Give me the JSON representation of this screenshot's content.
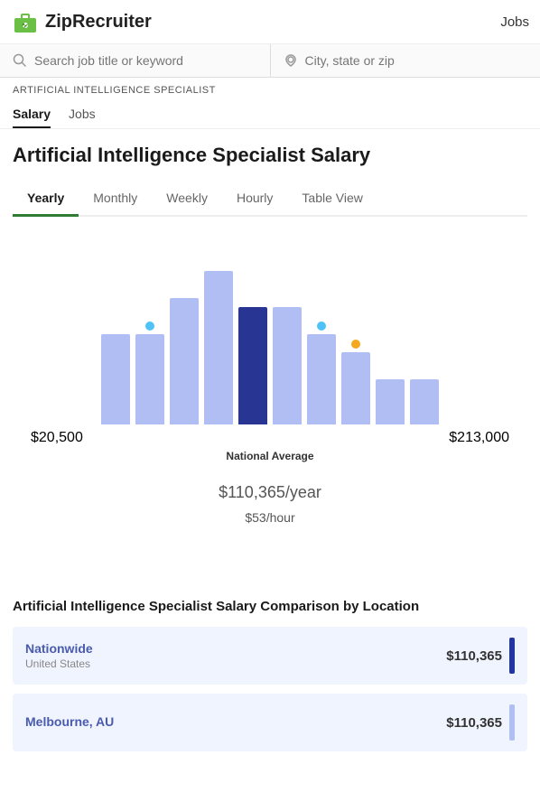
{
  "header": {
    "logo_text": "ZipRecruiter",
    "jobs_link": "Jobs"
  },
  "search": {
    "job_placeholder": "Search job title or keyword",
    "location_placeholder": "City, state or zip"
  },
  "breadcrumb": "ARTIFICIAL INTELLIGENCE SPECIALIST",
  "section_tabs": [
    {
      "label": "Salary",
      "active": true
    },
    {
      "label": "Jobs",
      "active": false
    }
  ],
  "page_title": "Artificial Intelligence Specialist Salary",
  "period_tabs": [
    {
      "label": "Yearly",
      "active": true
    },
    {
      "label": "Monthly",
      "active": false
    },
    {
      "label": "Weekly",
      "active": false
    },
    {
      "label": "Hourly",
      "active": false
    },
    {
      "label": "Table View",
      "active": false
    }
  ],
  "chart": {
    "left_label": "$20,500",
    "right_label": "$213,000",
    "national_avg_label": "National Average",
    "salary_year": "$110,365",
    "salary_year_suffix": "/year",
    "salary_hour": "$53",
    "salary_hour_suffix": "/hour"
  },
  "comparison": {
    "title": "Artificial Intelligence Specialist Salary Comparison by Location",
    "rows": [
      {
        "name": "Nationwide",
        "sub": "United States",
        "amount": "$110,365",
        "bar": "dark"
      },
      {
        "name": "Melbourne, AU",
        "sub": "",
        "amount": "$110,365",
        "bar": "light"
      }
    ]
  }
}
